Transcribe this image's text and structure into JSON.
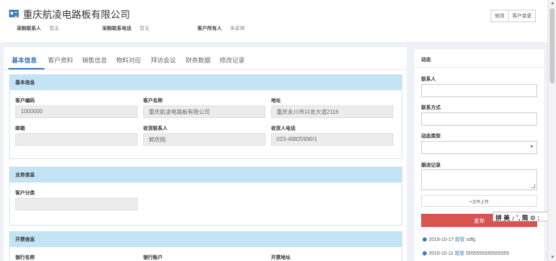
{
  "header": {
    "title": "重庆航凌电路板有限公司",
    "fields": [
      {
        "label": "采购联系人",
        "value": "暂无"
      },
      {
        "label": "采购联系电话",
        "value": "暂无"
      },
      {
        "label": "客户所有人",
        "value": "朱家琪"
      }
    ],
    "buttons": {
      "edit": "修改",
      "change": "客户变更"
    }
  },
  "tabs": [
    "基本信息",
    "客户资料",
    "销售信息",
    "物料对应",
    "拜访会议",
    "财务数据",
    "修改记录"
  ],
  "basic": {
    "title": "基本信息",
    "customer_code": {
      "label": "客户编码",
      "value": "1000000"
    },
    "customer_name": {
      "label": "客户名称",
      "value": "重庆航凌电路板有限公司"
    },
    "address": {
      "label": "地址",
      "value": "重庆永川市兴龙大道2116"
    },
    "email": {
      "label": "邮箱",
      "value": ""
    },
    "receiver": {
      "label": "收货联系人",
      "value": "郭庆翔"
    },
    "receiver_phone": {
      "label": "收货人电话",
      "value": "023-49825990/1"
    }
  },
  "business": {
    "title": "业务信息",
    "category": {
      "label": "客户分类",
      "value": ""
    }
  },
  "invoice": {
    "title": "开票信息",
    "bank_name": {
      "label": "银行名称"
    },
    "bank_account": {
      "label": "银行账户"
    },
    "invoice_address": {
      "label": "开票地址"
    }
  },
  "sidebar": {
    "title": "动态",
    "contact_label": "联系人",
    "method_label": "联系方式",
    "type_label": "动态类型",
    "record_label": "跟进记录",
    "upload_label": "+文件上传",
    "publish_label": "发布",
    "activities": [
      {
        "date": "2019-10-17",
        "who": "超管",
        "text": "sdfg"
      },
      {
        "date": "2019-10-11",
        "who": "超管",
        "text": "5555555555555555"
      }
    ]
  },
  "ime": {
    "text": "拼 美 ♪ ˚, 简 ⚙ :"
  },
  "colors": {
    "accent": "#3a76b8",
    "section_header": "#c4e3f4",
    "publish": "#d9534f"
  }
}
